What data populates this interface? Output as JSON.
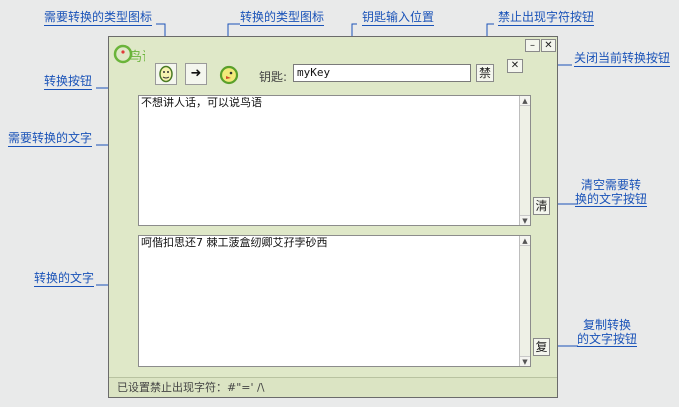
{
  "annotations": {
    "source_type_icon": "需要转换的类型图标",
    "target_type_icon": "转换的类型图标",
    "key_input_position": "钥匙输入位置",
    "ban_chars_button": "禁止出现字符按钮",
    "close_conversion_button": "关闭当前转换按钮",
    "convert_button": "转换按钮",
    "source_text": "需要转换的文字",
    "clear_button_line1": "清空需要转",
    "clear_button_line2": "换的文字按钮",
    "converted_text": "转换的文字",
    "copy_button_line1": "复制转换",
    "copy_button_line2": "的文字按钮"
  },
  "window": {
    "logo_text": "鸟语",
    "minimize": "–",
    "close": "✕"
  },
  "toolbar": {
    "source_icon": "face-icon",
    "convert_arrow": "➜",
    "target_icon": "bird-icon",
    "key_label": "钥匙:",
    "key_value": "myKey",
    "ban_label": "禁",
    "close_conversion": "✕"
  },
  "input_text": "不想讲人话，可以说鸟语",
  "output_text": "呵偕扣思还7 棘工菠盒纫卿艾孖孛砂西",
  "buttons": {
    "clear": "清",
    "copy": "复"
  },
  "status": "已设置禁止出现字符：#\"=' /\\",
  "colors": {
    "annotation": "#1a53b8",
    "window_bg": "#dfe8c8"
  }
}
